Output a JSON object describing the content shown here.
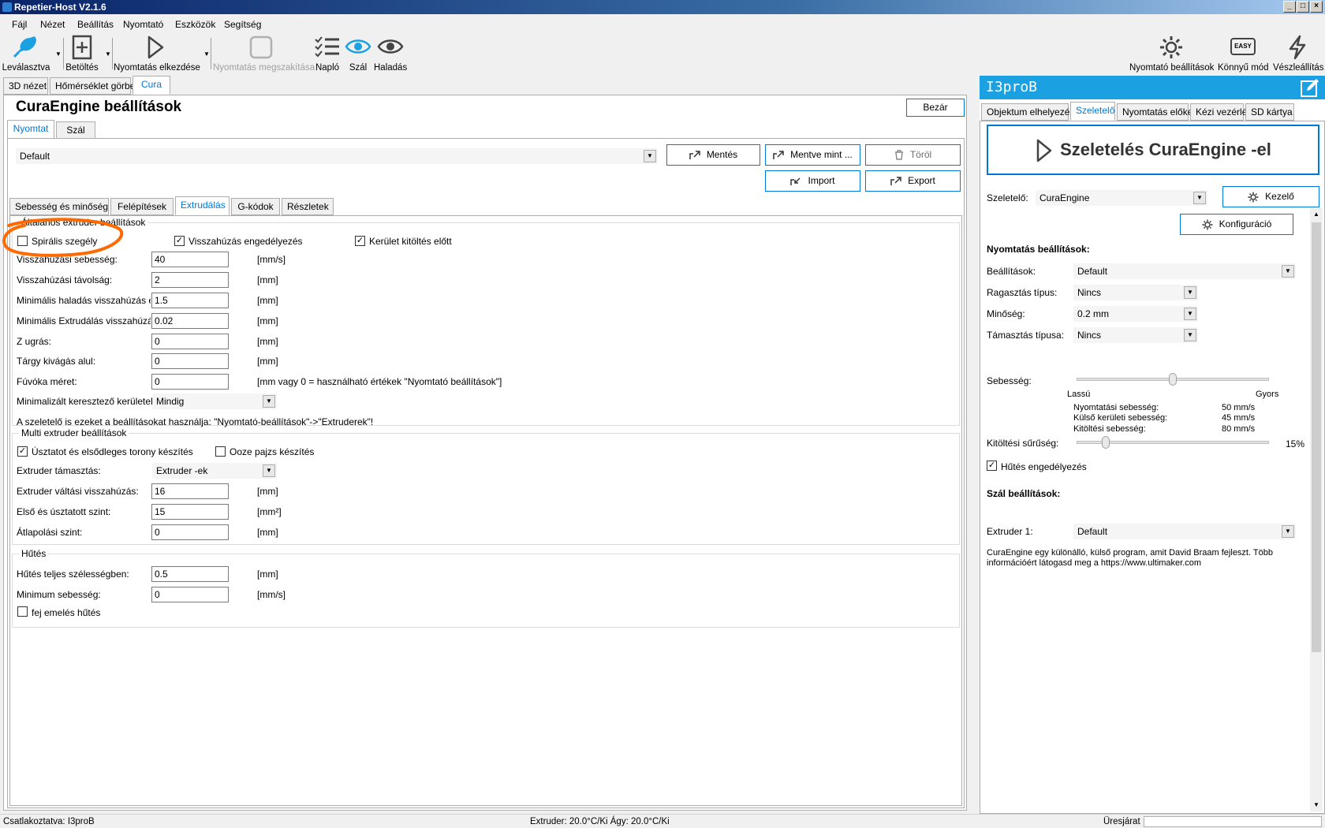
{
  "window": {
    "title": "Repetier-Host V2.1.6"
  },
  "menu": [
    "Fájl",
    "Nézet",
    "Beállítás",
    "Nyomtató",
    "Eszközök",
    "Segítség"
  ],
  "toolbar": {
    "disconnect": "Leválasztva",
    "load": "Betöltés",
    "start_print": "Nyomtatás elkezdése",
    "stop_print": "Nyomtatás megszakítása",
    "log": "Napló",
    "filament": "Szál",
    "progress": "Haladás",
    "printer_settings": "Nyomtató beállítások",
    "easy_mode": "Könnyű mód",
    "emergency_stop": "Vészleállítás",
    "easy_badge": "EASY"
  },
  "main_tabs": [
    "3D nézet",
    "Hőmérséklet görbe",
    "Cura"
  ],
  "cura": {
    "title": "CuraEngine beállítások",
    "close": "Bezár",
    "sub_tabs": [
      "Nyomtat",
      "Szál"
    ],
    "profile": "Default",
    "buttons": {
      "save": "Mentés",
      "save_as": "Mentve mint ...",
      "delete": "Töröl",
      "import": "Import",
      "export": "Export"
    },
    "settings_tabs": [
      "Sebesség és minőség",
      "Felépítések",
      "Extrudálás",
      "G-kódok",
      "Részletek"
    ],
    "extruder_group": {
      "title": "Általános extruder beállítások",
      "spiral": "Spirális szegély",
      "retraction_enabled": "Visszahúzás engedélyezés",
      "perimeter_before_infill": "Kerület kitöltés előtt",
      "rows": [
        {
          "label": "Visszahúzási sebesség:",
          "value": "40",
          "unit": "[mm/s]"
        },
        {
          "label": "Visszahúzási távolság:",
          "value": "2",
          "unit": "[mm]"
        },
        {
          "label": "Minimális haladás visszahúzás előtt:",
          "value": "1.5",
          "unit": "[mm]"
        },
        {
          "label": "Minimális Extrudálás visszahúzás előtt:",
          "value": "0.02",
          "unit": "[mm]"
        },
        {
          "label": "Z ugrás:",
          "value": "0",
          "unit": "[mm]"
        },
        {
          "label": "Tárgy kivágás alul:",
          "value": "0",
          "unit": "[mm]"
        },
        {
          "label": "Fúvóka méret:",
          "value": "0",
          "unit": "[mm vagy 0 = használható értékek \"Nyomtató beállítások\"]"
        }
      ],
      "minimize_label": "Minimalizált keresztező kerületek:",
      "minimize_value": "Mindig",
      "note": "A szeletelő is ezeket a beállításokat használja: \"Nyomtató-beállítások\"->\"Extruderek\"!"
    },
    "multi_group": {
      "title": "Multi extruder beállítások",
      "wipe_tower": "Úsztatot és elsődleges torony készítés",
      "ooze_shield": "Ooze pajzs készítés",
      "support_label": "Extruder támasztás:",
      "support_value": "Extruder -ek",
      "rows": [
        {
          "label": "Extruder váltási visszahúzás:",
          "value": "16",
          "unit": "[mm]"
        },
        {
          "label": "Első és úsztatott szint:",
          "value": "15",
          "unit": "[mm²]"
        },
        {
          "label": "Átlapolási szint:",
          "value": "0",
          "unit": "[mm]"
        }
      ]
    },
    "cooling_group": {
      "title": "Hűtés",
      "rows": [
        {
          "label": "Hűtés teljes szélességben:",
          "value": "0.5",
          "unit": "[mm]"
        },
        {
          "label": "Minimum sebesség:",
          "value": "0",
          "unit": "[mm/s]"
        }
      ],
      "head_lift": "fej emelés hűtés"
    }
  },
  "right": {
    "printer_name": "I3proB",
    "tabs": [
      "Objektum elhelyezése",
      "Szeletelő",
      "Nyomtatás előkép",
      "Kézi vezérlés",
      "SD kártya"
    ],
    "slice_button": "Szeletelés CuraEngine -el",
    "slicer_label": "Szeletelő:",
    "slicer_value": "CuraEngine",
    "manager": "Kezelő",
    "config": "Konfiguráció",
    "print_settings_title": "Nyomtatás beállítások:",
    "settings_label": "Beállítások:",
    "settings_value": "Default",
    "adhesion_label": "Ragasztás típus:",
    "adhesion_value": "Nincs",
    "quality_label": "Minőség:",
    "quality_value": "0.2 mm",
    "support_label": "Támasztás típusa:",
    "support_value": "Nincs",
    "speed_label": "Sebesség:",
    "slow": "Lassú",
    "fast": "Gyors",
    "speed_level": 0.5,
    "print_speed_label": "Nyomtatási sebesség:",
    "print_speed": "50 mm/s",
    "outer_speed_label": "Külső kerületi sebesség:",
    "outer_speed": "45 mm/s",
    "infill_speed_label": "Kitöltési sebesség:",
    "infill_speed": "80 mm/s",
    "infill_density_label": "Kitöltési sűrűség:",
    "infill_density": "15%",
    "infill_level": 0.15,
    "cooling": "Hűtés engedélyezés",
    "filament_title": "Szál beállítások:",
    "extruder1_label": "Extruder 1:",
    "extruder1_value": "Default",
    "info": "CuraEngine egy különálló, külső program, amit David Braam fejleszt. Több információért látogasd meg a https://www.ultimaker.com"
  },
  "status": {
    "connection": "Csatlakoztatva: I3proB",
    "temps": "Extruder: 20.0°C/Ki Ágy: 20.0°C/Ki",
    "idle": "Üresjárat"
  },
  "colors": {
    "accent": "#0078d7",
    "cyan": "#1ba1e2",
    "annotation": "#ff6a00"
  }
}
